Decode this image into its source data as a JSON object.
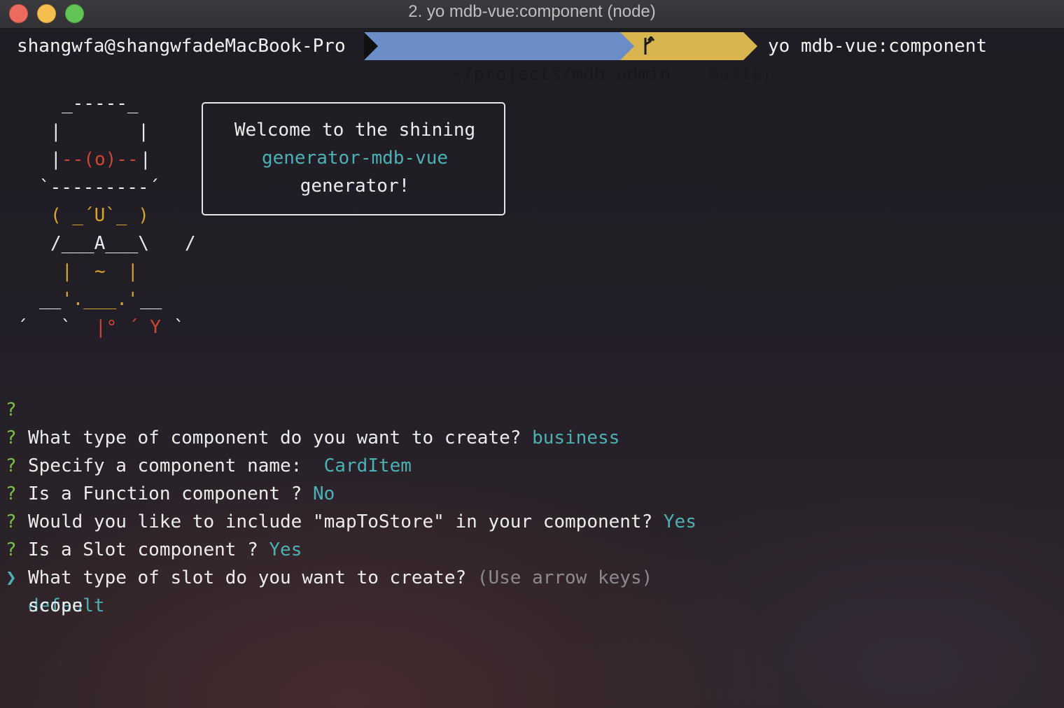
{
  "window": {
    "title": "2. yo mdb-vue:component (node)"
  },
  "prompt": {
    "user_host": "shangwfa@shangwfadeMacBook-Pro",
    "path": "~/projects/mdb-admin",
    "branch": "master",
    "command": "yo mdb-vue:component"
  },
  "ascii_art": {
    "line1": "_-----_",
    "line2": "|       |",
    "line3_left": "|",
    "line3_mid": "--(o)--",
    "line3_right": "|",
    "line4": "`---------´",
    "line5": "( _´U`_ )",
    "line6_left": "/___A___\\",
    "line6_right": "/",
    "line7": "|  ~  |",
    "line8_left": "__",
    "line8_mid": "'.___.'",
    "line8_right": "__",
    "line9_left": "´   `",
    "line9_mid": "|° ´ Y",
    "line9_right": "`"
  },
  "welcome": {
    "line1": "Welcome to the shining",
    "line2": "generator-mdb-vue",
    "line3": "generator!"
  },
  "questions": [
    {
      "mark": "?",
      "text": "What type of component do you want to create?",
      "answer": "business"
    },
    {
      "mark": "?",
      "text": "Specify a component name:",
      "answer": "CardItem"
    },
    {
      "mark": "?",
      "text": "Is a Function component ?",
      "answer": "No"
    },
    {
      "mark": "?",
      "text": "Would you like to include \"mapToStore\" in your component?",
      "answer": "Yes"
    },
    {
      "mark": "?",
      "text": "Is a Slot component ?",
      "answer": "Yes"
    },
    {
      "mark": "?",
      "text": "What type of slot do you want to create?",
      "hint": "(Use arrow keys)"
    }
  ],
  "choices": {
    "pointer": "❯",
    "selected": "default",
    "other": "scope"
  },
  "colors": {
    "accent_teal": "#4bb1b5",
    "question_mark_green": "#7ec142",
    "path_segment_blue": "#6b8ec9",
    "git_segment_yellow": "#d9b54f",
    "art_red": "#d2452f",
    "art_yellow": "#d8a52a"
  }
}
